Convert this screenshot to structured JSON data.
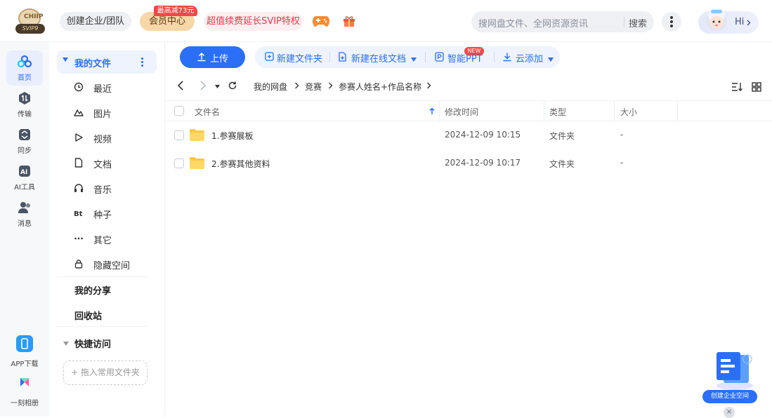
{
  "topbar": {
    "logo_text": "CHIIP",
    "logo_tag": "SVIP9",
    "org_button": "创建企业/团队",
    "vip_button": "会员中心",
    "vip_badge": "最高减73元",
    "renew_button": "超值续费延长SVIP特权",
    "search_placeholder": "搜网盘文件、全网资源资讯",
    "search_button": "搜索",
    "hi_label": "Hi"
  },
  "rail": {
    "items": [
      {
        "label": "首页",
        "icon": "cloud-icon"
      },
      {
        "label": "传输",
        "icon": "transfer-icon"
      },
      {
        "label": "同步",
        "icon": "sync-icon"
      },
      {
        "label": "AI工具",
        "icon": "ai-icon"
      },
      {
        "label": "消息",
        "icon": "message-icon"
      }
    ],
    "bottom": [
      {
        "label": "APP下载",
        "icon": "phone-icon"
      },
      {
        "label": "一刻相册",
        "icon": "album-icon"
      }
    ]
  },
  "sidebar": {
    "my_files": "我的文件",
    "items": [
      {
        "label": "最近",
        "icon": "clock-icon"
      },
      {
        "label": "图片",
        "icon": "image-icon"
      },
      {
        "label": "视频",
        "icon": "play-icon"
      },
      {
        "label": "文档",
        "icon": "document-icon"
      },
      {
        "label": "音乐",
        "icon": "headphones-icon"
      },
      {
        "label": "种子",
        "icon": "bt-icon"
      },
      {
        "label": "其它",
        "icon": "ellipsis-icon"
      },
      {
        "label": "隐藏空间",
        "icon": "lock-icon"
      }
    ],
    "my_share": "我的分享",
    "recycle": "回收站",
    "quick_access": "快捷访问",
    "drop_hint": "+ 拖入常用文件夹"
  },
  "toolbar": {
    "upload": "上传",
    "new_folder": "新建文件夹",
    "new_online_doc": "新建在线文档",
    "new_badge": "NEW",
    "smart_ppt": "智能PPT",
    "cloud_add": "云添加"
  },
  "breadcrumb": [
    "我的网盘",
    "竞赛",
    "参赛人姓名+作品名称"
  ],
  "table": {
    "headers": {
      "name": "文件名",
      "modified": "修改时间",
      "type": "类型",
      "size": "大小"
    },
    "rows": [
      {
        "name": "1.参赛展板",
        "modified": "2024-12-09 10:15",
        "type": "文件夹",
        "size": "-"
      },
      {
        "name": "2.参赛其他资料",
        "modified": "2024-12-09 10:17",
        "type": "文件夹",
        "size": "-"
      }
    ]
  },
  "enterprise_widget": {
    "button": "创建企业空间",
    "close": "×"
  },
  "colors": {
    "accent": "#2a6ff6",
    "vip": "#f6d7a8",
    "badge": "#f04848",
    "folder": "#ffc83d"
  }
}
